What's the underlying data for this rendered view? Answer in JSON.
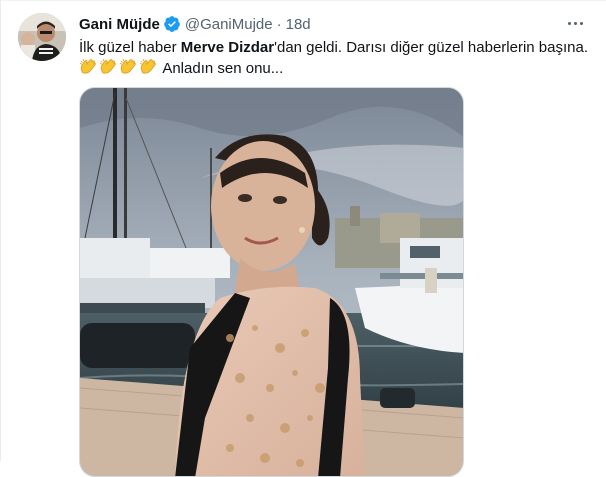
{
  "tweet": {
    "author_name": "Gani Müjde",
    "handle": "@GaniMujde",
    "separator": "·",
    "time": "18d",
    "text_part1": "İlk güzel haber ",
    "text_bold": "Merve Dizdar",
    "text_part2": "'dan geldi. Darısı diğer güzel haberlerin başına.",
    "text_part3": " Anladın sen onu...",
    "emoji": "clapping-hands-icon",
    "emoji_count": 4
  },
  "colors": {
    "verified": "#1d9bf0",
    "text": "#0f1419",
    "secondary": "#536471"
  }
}
